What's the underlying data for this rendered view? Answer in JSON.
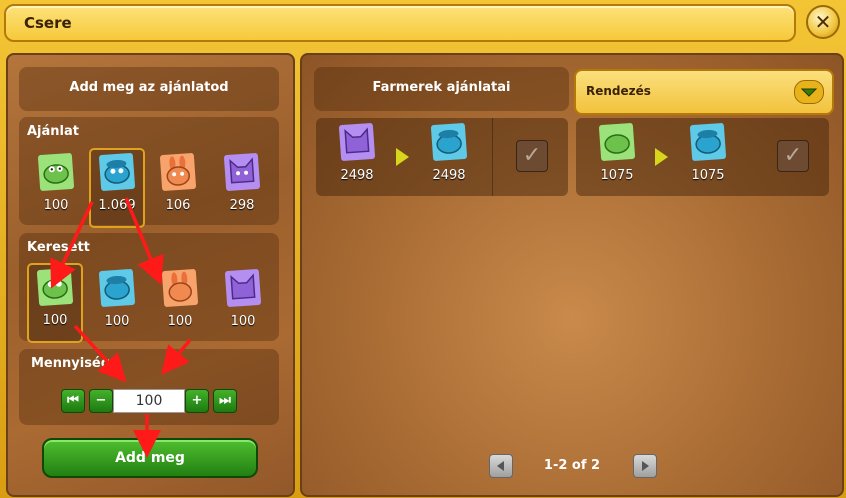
{
  "window": {
    "title": "Csere",
    "close_label": "✕"
  },
  "left": {
    "header": "Add meg az ajánlatod",
    "offer_section": "Ajánlat",
    "offer_items": [
      {
        "icon": "green-croc-icon",
        "value": "100",
        "color": "#9be27a"
      },
      {
        "icon": "blue-hippo-icon",
        "value": "1.069",
        "color": "#5fc9e8"
      },
      {
        "icon": "orange-rabbit-icon",
        "value": "106",
        "color": "#f8a36b"
      },
      {
        "icon": "purple-cat-icon",
        "value": "298",
        "color": "#b48ef0"
      }
    ],
    "wanted_section": "Keresett",
    "wanted_items": [
      {
        "icon": "green-croc-icon",
        "value": "100",
        "color": "#9be27a"
      },
      {
        "icon": "blue-hippo-icon",
        "value": "100",
        "color": "#5fc9e8"
      },
      {
        "icon": "orange-rabbit-icon",
        "value": "100",
        "color": "#f8a36b"
      },
      {
        "icon": "purple-cat-icon",
        "value": "100",
        "color": "#b48ef0"
      }
    ],
    "quantity_label": "Mennyiség",
    "quantity_value": "100",
    "add_button": "Add meg"
  },
  "right": {
    "header": "Farmerek ajánlatai",
    "sort_label": "Rendezés",
    "offers": [
      {
        "give_icon": "purple-cat-icon",
        "give_value": "2498",
        "get_icon": "blue-hippo-icon",
        "get_value": "2498"
      },
      {
        "give_icon": "green-croc-icon",
        "give_value": "1075",
        "get_icon": "blue-hippo-icon",
        "get_value": "1075"
      }
    ],
    "pagination": "1-2 of 2"
  },
  "colors": {
    "accent_green": "#2f9a1a",
    "frame_gold": "#f0c030",
    "annotation_red": "#ff1a1a"
  }
}
